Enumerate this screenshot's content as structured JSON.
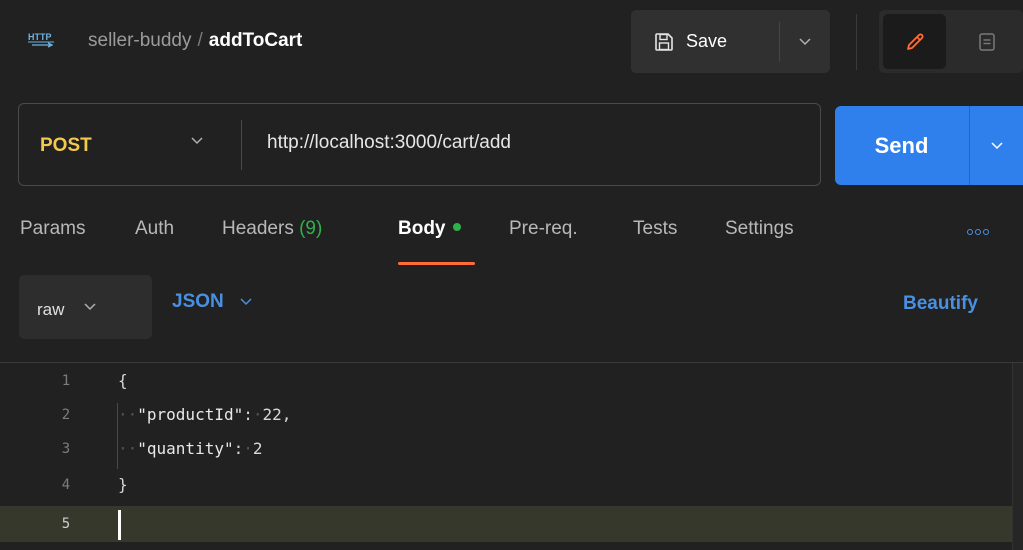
{
  "header": {
    "icon": "http-icon",
    "icon_text": "HTTP",
    "collection": "seller-buddy",
    "separator": "/",
    "request_name": "addToCart",
    "save_label": "Save"
  },
  "request": {
    "method": "POST",
    "url": "http://localhost:3000/cart/add",
    "send_label": "Send"
  },
  "tabs": [
    {
      "label": "Params"
    },
    {
      "label": "Auth"
    },
    {
      "label": "Headers",
      "count": "(9)"
    },
    {
      "label": "Body",
      "active": true,
      "indicator": "green-dot"
    },
    {
      "label": "Pre-req."
    },
    {
      "label": "Tests"
    },
    {
      "label": "Settings"
    }
  ],
  "body_options": {
    "mode": "raw",
    "language": "JSON",
    "beautify_label": "Beautify"
  },
  "editor": {
    "lines": [
      {
        "num": "1",
        "text": "{"
      },
      {
        "num": "2",
        "key": "\"productId\"",
        "value": "22,"
      },
      {
        "num": "3",
        "key": "\"quantity\"",
        "value": "2"
      },
      {
        "num": "4",
        "text": "}"
      },
      {
        "num": "5",
        "text": ""
      }
    ]
  },
  "colors": {
    "accent_blue": "#2f80ed",
    "method_yellow": "#f2c94c",
    "active_tab_underline": "#ff6c37",
    "status_green": "#2fb14a"
  }
}
